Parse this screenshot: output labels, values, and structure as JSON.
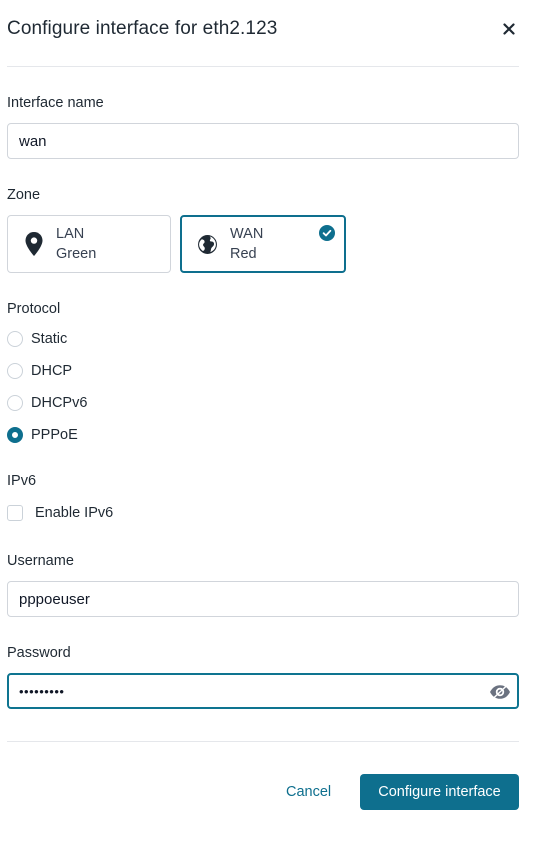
{
  "dialog": {
    "title": "Configure interface for eth2.123",
    "close_icon": "close-icon"
  },
  "interface_name": {
    "label": "Interface name",
    "value": "wan"
  },
  "zone": {
    "label": "Zone",
    "options": [
      {
        "name": "LAN",
        "color": "Green",
        "icon": "map-pin-icon",
        "selected": false
      },
      {
        "name": "WAN",
        "color": "Red",
        "icon": "globe-icon",
        "selected": true
      }
    ],
    "accent": "#0e6f8e"
  },
  "protocol": {
    "label": "Protocol",
    "options": [
      "Static",
      "DHCP",
      "DHCPv6",
      "PPPoE"
    ],
    "selected": "PPPoE"
  },
  "ipv6": {
    "label": "IPv6",
    "checkbox_label": "Enable IPv6",
    "checked": false
  },
  "username": {
    "label": "Username",
    "value": "pppoeuser"
  },
  "password": {
    "label": "Password",
    "value": "•••••••••",
    "reveal_icon": "eye-icon"
  },
  "actions": {
    "cancel_label": "Cancel",
    "submit_label": "Configure interface"
  }
}
